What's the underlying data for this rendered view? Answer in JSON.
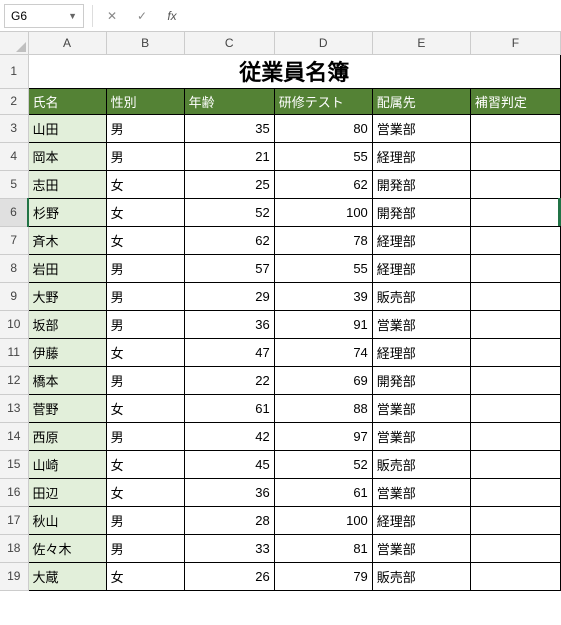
{
  "name_box": "G6",
  "formula_value": "",
  "columns": [
    "A",
    "B",
    "C",
    "D",
    "E",
    "F"
  ],
  "title": "従業員名簿",
  "headers": [
    "氏名",
    "性別",
    "年齢",
    "研修テスト",
    "配属先",
    "補習判定"
  ],
  "rows": [
    {
      "n": 3,
      "name": "山田",
      "sex": "男",
      "age": 35,
      "score": 80,
      "dept": "営業部",
      "rem": ""
    },
    {
      "n": 4,
      "name": "岡本",
      "sex": "男",
      "age": 21,
      "score": 55,
      "dept": "経理部",
      "rem": ""
    },
    {
      "n": 5,
      "name": "志田",
      "sex": "女",
      "age": 25,
      "score": 62,
      "dept": "開発部",
      "rem": ""
    },
    {
      "n": 6,
      "name": "杉野",
      "sex": "女",
      "age": 52,
      "score": 100,
      "dept": "開発部",
      "rem": ""
    },
    {
      "n": 7,
      "name": "斉木",
      "sex": "女",
      "age": 62,
      "score": 78,
      "dept": "経理部",
      "rem": ""
    },
    {
      "n": 8,
      "name": "岩田",
      "sex": "男",
      "age": 57,
      "score": 55,
      "dept": "経理部",
      "rem": ""
    },
    {
      "n": 9,
      "name": "大野",
      "sex": "男",
      "age": 29,
      "score": 39,
      "dept": "販売部",
      "rem": ""
    },
    {
      "n": 10,
      "name": "坂部",
      "sex": "男",
      "age": 36,
      "score": 91,
      "dept": "営業部",
      "rem": ""
    },
    {
      "n": 11,
      "name": "伊藤",
      "sex": "女",
      "age": 47,
      "score": 74,
      "dept": "経理部",
      "rem": ""
    },
    {
      "n": 12,
      "name": "橋本",
      "sex": "男",
      "age": 22,
      "score": 69,
      "dept": "開発部",
      "rem": ""
    },
    {
      "n": 13,
      "name": "菅野",
      "sex": "女",
      "age": 61,
      "score": 88,
      "dept": "営業部",
      "rem": ""
    },
    {
      "n": 14,
      "name": "西原",
      "sex": "男",
      "age": 42,
      "score": 97,
      "dept": "営業部",
      "rem": ""
    },
    {
      "n": 15,
      "name": "山崎",
      "sex": "女",
      "age": 45,
      "score": 52,
      "dept": "販売部",
      "rem": ""
    },
    {
      "n": 16,
      "name": "田辺",
      "sex": "女",
      "age": 36,
      "score": 61,
      "dept": "営業部",
      "rem": ""
    },
    {
      "n": 17,
      "name": "秋山",
      "sex": "男",
      "age": 28,
      "score": 100,
      "dept": "経理部",
      "rem": ""
    },
    {
      "n": 18,
      "name": "佐々木",
      "sex": "男",
      "age": 33,
      "score": 81,
      "dept": "営業部",
      "rem": ""
    },
    {
      "n": 19,
      "name": "大蔵",
      "sex": "女",
      "age": 26,
      "score": 79,
      "dept": "販売部",
      "rem": ""
    }
  ],
  "chart_data": {
    "type": "table",
    "title": "従業員名簿",
    "columns": [
      "氏名",
      "性別",
      "年齢",
      "研修テスト",
      "配属先",
      "補習判定"
    ],
    "data": [
      [
        "山田",
        "男",
        35,
        80,
        "営業部",
        ""
      ],
      [
        "岡本",
        "男",
        21,
        55,
        "経理部",
        ""
      ],
      [
        "志田",
        "女",
        25,
        62,
        "開発部",
        ""
      ],
      [
        "杉野",
        "女",
        52,
        100,
        "開発部",
        ""
      ],
      [
        "斉木",
        "女",
        62,
        78,
        "経理部",
        ""
      ],
      [
        "岩田",
        "男",
        57,
        55,
        "経理部",
        ""
      ],
      [
        "大野",
        "男",
        29,
        39,
        "販売部",
        ""
      ],
      [
        "坂部",
        "男",
        36,
        91,
        "営業部",
        ""
      ],
      [
        "伊藤",
        "女",
        47,
        74,
        "経理部",
        ""
      ],
      [
        "橋本",
        "男",
        22,
        69,
        "開発部",
        ""
      ],
      [
        "菅野",
        "女",
        61,
        88,
        "営業部",
        ""
      ],
      [
        "西原",
        "男",
        42,
        97,
        "営業部",
        ""
      ],
      [
        "山崎",
        "女",
        45,
        52,
        "販売部",
        ""
      ],
      [
        "田辺",
        "女",
        36,
        61,
        "営業部",
        ""
      ],
      [
        "秋山",
        "男",
        28,
        100,
        "経理部",
        ""
      ],
      [
        "佐々木",
        "男",
        33,
        81,
        "営業部",
        ""
      ],
      [
        "大蔵",
        "女",
        26,
        79,
        "販売部",
        ""
      ]
    ]
  }
}
